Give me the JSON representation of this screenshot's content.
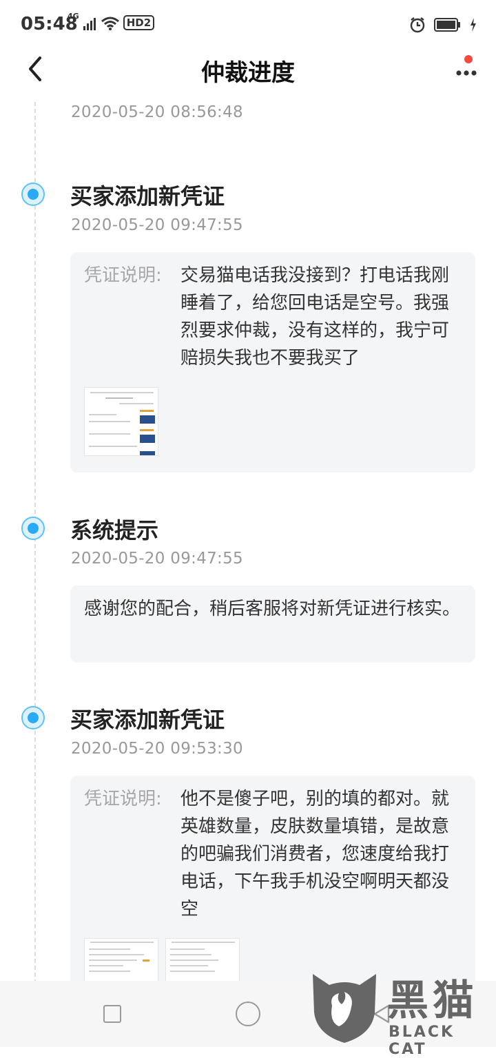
{
  "status_bar": {
    "time": "05:48",
    "network": "4G",
    "hd": "HD2",
    "icons": [
      "signal-icon",
      "wifi-icon",
      "hd-icon",
      "alarm-icon",
      "battery-icon",
      "charging-icon"
    ]
  },
  "header": {
    "title": "仲裁进度",
    "back_icon": "chevron-left-icon",
    "more_icon": "more-icon",
    "notification_color": "#f24a3d"
  },
  "timeline": {
    "accent_color": "#2aaaf4",
    "top_time": "2020-05-20 08:56:48",
    "events": [
      {
        "title": "买家添加新凭证",
        "time": "2020-05-20 09:47:55",
        "proof_label": "凭证说明:",
        "proof_text": "交易猫电话我没接到？打电话我刚睡着了，给您回电话是空号。我强烈要求仲裁，没有这样的，我宁可赔损失我也不要我买了"
      },
      {
        "title": "系统提示",
        "time": "2020-05-20 09:47:55",
        "message": "感谢您的配合，稍后客服将对新凭证进行核实。"
      },
      {
        "title": "买家添加新凭证",
        "time": "2020-05-20 09:53:30",
        "proof_label": "凭证说明:",
        "proof_text": "他不是傻子吧，别的填的都对。就英雄数量，皮肤数量填错，是故意的吧骗我们消费者，您速度给我打电话，下午我手机没空啊明天都没空"
      }
    ]
  },
  "bottom_nav": {
    "icons": [
      "recent-apps-icon",
      "home-icon",
      "back-icon"
    ]
  },
  "watermark": {
    "cn": "黑猫",
    "en": "BLACK CAT"
  }
}
